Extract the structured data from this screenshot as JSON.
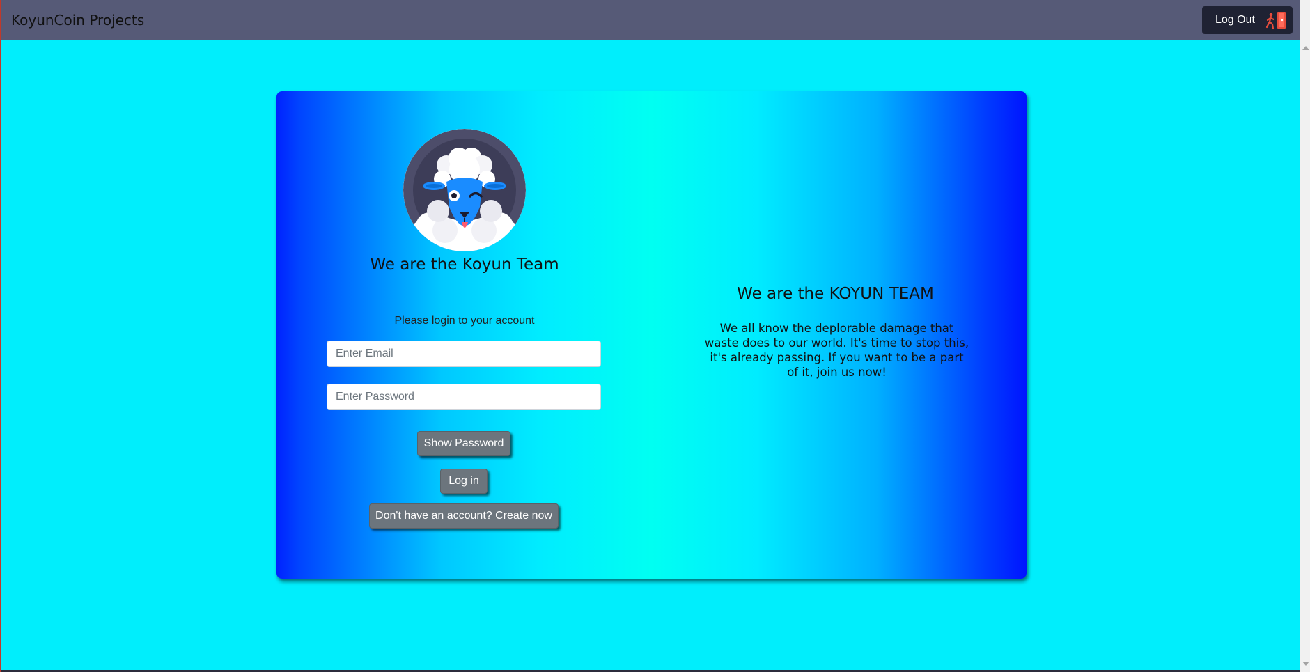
{
  "navbar": {
    "brand": "KoyunCoin Projects",
    "logout_label": "Log Out",
    "logout_icon": "exit-door-icon"
  },
  "card": {
    "avatar_icon": "sheep-avatar-icon",
    "left_title": "We are the Koyun Team",
    "login_prompt": "Please login to your account",
    "email_placeholder": "Enter Email",
    "password_placeholder": "Enter Password",
    "show_password_label": "Show Password",
    "login_label": "Log in",
    "create_account_label": "Don't have an account? Create now",
    "right_title": "We are the KOYUN TEAM",
    "right_text": "We all know the deplorable damage that waste does to our world. It's time to stop this, it's already passing. If you want to be a part of it, join us now!"
  },
  "colors": {
    "page_background": "#00eefc",
    "navbar": "#565a77",
    "logout_button": "#1f2233",
    "button_gray": "#6c757d",
    "card_gradient_edge": "#0022ff",
    "card_gradient_center": "#00fff2"
  }
}
